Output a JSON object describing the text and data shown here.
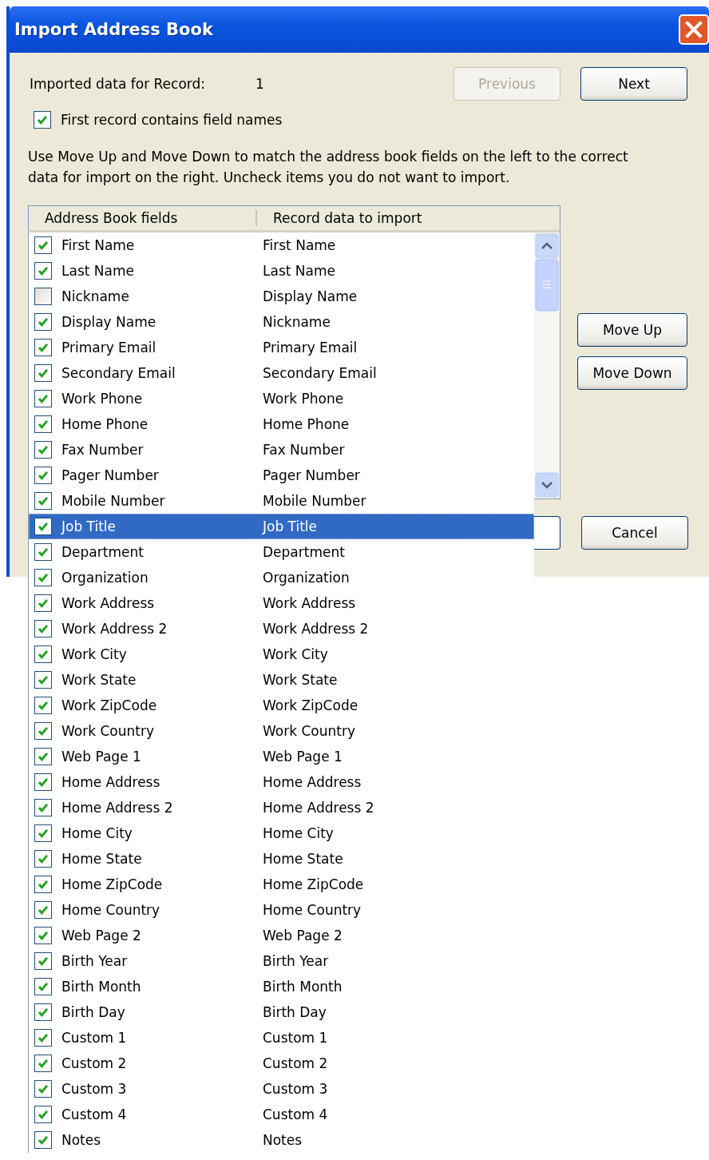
{
  "window": {
    "title": "Import Address Book"
  },
  "record": {
    "label": "Imported data for Record:",
    "value": "1"
  },
  "nav_buttons": [
    {
      "label": "Previous",
      "disabled": true
    },
    {
      "label": "Next",
      "disabled": false
    }
  ],
  "first_record_checkbox": {
    "label": "First record contains field names",
    "checked": true
  },
  "instructions": "Use Move Up and Move Down to match the address book fields on the left to the correct data for import on the right. Uncheck items you do not want to import.",
  "table": {
    "columns": [
      "Address Book fields",
      "Record data to import"
    ],
    "rows": [
      {
        "field": "First Name",
        "data": "First Name",
        "checked": true,
        "selected": false
      },
      {
        "field": "Last Name",
        "data": "Last Name",
        "checked": true,
        "selected": false
      },
      {
        "field": "Nickname",
        "data": "Display Name",
        "checked": false,
        "selected": false
      },
      {
        "field": "Display Name",
        "data": "Nickname",
        "checked": true,
        "selected": false
      },
      {
        "field": "Primary Email",
        "data": "Primary Email",
        "checked": true,
        "selected": false
      },
      {
        "field": "Secondary Email",
        "data": "Secondary Email",
        "checked": true,
        "selected": false
      },
      {
        "field": "Work Phone",
        "data": "Work Phone",
        "checked": true,
        "selected": false
      },
      {
        "field": "Home Phone",
        "data": "Home Phone",
        "checked": true,
        "selected": false
      },
      {
        "field": "Fax Number",
        "data": "Fax Number",
        "checked": true,
        "selected": false
      },
      {
        "field": "Pager Number",
        "data": "Pager Number",
        "checked": true,
        "selected": false
      },
      {
        "field": "Mobile Number",
        "data": "Mobile Number",
        "checked": true,
        "selected": false
      },
      {
        "field": "Job Title",
        "data": "Job Title",
        "checked": true,
        "selected": true
      },
      {
        "field": "Department",
        "data": "Department",
        "checked": true,
        "selected": false
      },
      {
        "field": "Organization",
        "data": "Organization",
        "checked": true,
        "selected": false
      },
      {
        "field": "Work Address",
        "data": "Work Address",
        "checked": true,
        "selected": false
      },
      {
        "field": "Work Address 2",
        "data": "Work Address 2",
        "checked": true,
        "selected": false
      },
      {
        "field": "Work City",
        "data": "Work City",
        "checked": true,
        "selected": false
      },
      {
        "field": "Work State",
        "data": "Work State",
        "checked": true,
        "selected": false
      },
      {
        "field": "Work ZipCode",
        "data": "Work ZipCode",
        "checked": true,
        "selected": false
      },
      {
        "field": "Work Country",
        "data": "Work Country",
        "checked": true,
        "selected": false
      },
      {
        "field": "Web Page 1",
        "data": "Web Page 1",
        "checked": true,
        "selected": false
      },
      {
        "field": "Home Address",
        "data": "Home Address",
        "checked": true,
        "selected": false
      },
      {
        "field": "Home Address 2",
        "data": "Home Address 2",
        "checked": true,
        "selected": false
      },
      {
        "field": "Home City",
        "data": "Home City",
        "checked": true,
        "selected": false
      },
      {
        "field": "Home State",
        "data": "Home State",
        "checked": true,
        "selected": false
      },
      {
        "field": "Home ZipCode",
        "data": "Home ZipCode",
        "checked": true,
        "selected": false
      },
      {
        "field": "Home Country",
        "data": "Home Country",
        "checked": true,
        "selected": false
      },
      {
        "field": "Web Page 2",
        "data": "Web Page 2",
        "checked": true,
        "selected": false
      },
      {
        "field": "Birth Year",
        "data": "Birth Year",
        "checked": true,
        "selected": false
      },
      {
        "field": "Birth Month",
        "data": "Birth Month",
        "checked": true,
        "selected": false
      },
      {
        "field": "Birth Day",
        "data": "Birth Day",
        "checked": true,
        "selected": false
      },
      {
        "field": "Custom 1",
        "data": "Custom 1",
        "checked": true,
        "selected": false
      },
      {
        "field": "Custom 2",
        "data": "Custom 2",
        "checked": true,
        "selected": false
      },
      {
        "field": "Custom 3",
        "data": "Custom 3",
        "checked": true,
        "selected": false
      },
      {
        "field": "Custom 4",
        "data": "Custom 4",
        "checked": true,
        "selected": false
      },
      {
        "field": "Notes",
        "data": "Notes",
        "checked": true,
        "selected": false
      }
    ]
  },
  "side_buttons": [
    {
      "label": "Move Up"
    },
    {
      "label": "Move Down"
    }
  ],
  "bottom_buttons": [
    {
      "label": "Cancel"
    }
  ]
}
